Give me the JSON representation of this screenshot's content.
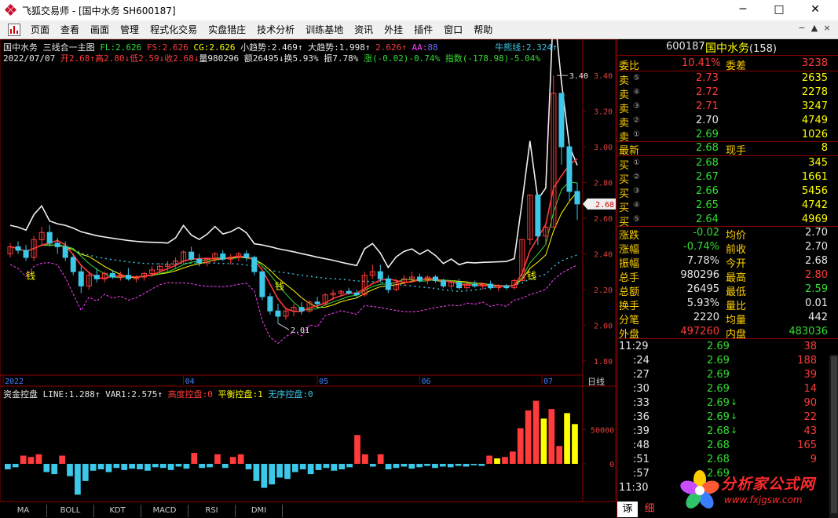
{
  "window": {
    "title": "飞狐交易师 - [国中水务 SH600187]",
    "minimize": "─",
    "maximize": "□",
    "close": "✕"
  },
  "menu": [
    "页面",
    "查看",
    "画面",
    "管理",
    "程式化交易",
    "实盘猎庄",
    "技术分析",
    "训练基地",
    "资讯",
    "外挂",
    "插件",
    "窗口",
    "帮助"
  ],
  "mdi_buttons": [
    "−",
    "▲",
    "×"
  ],
  "colors": {
    "up": "#ff3b3b",
    "down": "#33dd33",
    "label": "#ffd000",
    "cyan": "#3cc8e8",
    "yellow": "#ffff00",
    "magenta": "#ff40ff",
    "grid": "#8b0000"
  },
  "main_header": {
    "stock": "国中水务",
    "formula": "三线合一主图",
    "fl": "FL:2.626",
    "fs": "FS:2.626",
    "cg": "CG:2.626",
    "small_trend": "小趋势:2.469",
    "big_trend": "大趋势:1.998",
    "v3": "2.626",
    "aa": "AA:",
    "aa_val": "88",
    "bear_line": "牛熊线:2.324",
    "date": "2022/07/07",
    "open": "开2.68",
    "high": "高2.80",
    "low": "低2.59",
    "close": "收2.68",
    "volume": "量980296",
    "amount": "额26495",
    "turnover": "换5.93%",
    "amplitude": "振7.78%",
    "change": "涨(-0.02)-0.74%",
    "index": "指数(-178.98)-5.04%"
  },
  "chart_annotations": {
    "high_label": "3.40",
    "low_label": "2.01",
    "current_price_tag": "2.68",
    "money_icon_label": "钱",
    "period_label": "日线"
  },
  "sub_header": {
    "name": "资金控盘",
    "line": "LINE:1.288",
    "var1": "VAR1:2.575",
    "high_ctrl": "高度控盘:0",
    "balance_ctrl": "平衡控盘:1",
    "no_ctrl": "无序控盘:0"
  },
  "indicator_tabs": [
    "MA",
    "BOLL",
    "KDT",
    "MACD",
    "RSI",
    "DMI"
  ],
  "chart_data": [
    {
      "type": "candlestick",
      "title": "三线合一主图",
      "x_ticks": [
        "2022",
        "04",
        "05",
        "06",
        "07"
      ],
      "y_ticks": [
        1.8,
        2.0,
        2.2,
        2.4,
        2.6,
        2.8,
        3.0,
        3.2,
        3.4
      ],
      "ylim": [
        1.72,
        3.48
      ],
      "series": [
        {
          "name": "FL",
          "color": "#33dd33"
        },
        {
          "name": "FS",
          "color": "#ff3b3b"
        },
        {
          "name": "CG",
          "color": "#ffff00"
        },
        {
          "name": "小趋势",
          "color": "#ff40ff"
        },
        {
          "name": "大趋势",
          "color": "#e8e8e8"
        },
        {
          "name": "牛熊线",
          "color": "#3cc8e8"
        }
      ],
      "candles": [
        [
          2.4,
          2.46,
          2.38,
          2.44
        ],
        [
          2.44,
          2.47,
          2.4,
          2.42
        ],
        [
          2.42,
          2.45,
          2.36,
          2.38
        ],
        [
          2.38,
          2.5,
          2.36,
          2.48
        ],
        [
          2.48,
          2.55,
          2.45,
          2.52
        ],
        [
          2.52,
          2.56,
          2.44,
          2.46
        ],
        [
          2.46,
          2.49,
          2.4,
          2.44
        ],
        [
          2.44,
          2.47,
          2.36,
          2.38
        ],
        [
          2.38,
          2.4,
          2.28,
          2.3
        ],
        [
          2.3,
          2.33,
          2.18,
          2.22
        ],
        [
          2.22,
          2.3,
          2.2,
          2.28
        ],
        [
          2.28,
          2.32,
          2.24,
          2.26
        ],
        [
          2.26,
          2.3,
          2.24,
          2.29
        ],
        [
          2.29,
          2.31,
          2.26,
          2.27
        ],
        [
          2.27,
          2.3,
          2.25,
          2.28
        ],
        [
          2.28,
          2.32,
          2.25,
          2.26
        ],
        [
          2.26,
          2.28,
          2.24,
          2.27
        ],
        [
          2.27,
          2.3,
          2.25,
          2.29
        ],
        [
          2.29,
          2.33,
          2.27,
          2.31
        ],
        [
          2.31,
          2.35,
          2.29,
          2.33
        ],
        [
          2.33,
          2.36,
          2.3,
          2.34
        ],
        [
          2.34,
          2.38,
          2.32,
          2.36
        ],
        [
          2.36,
          2.42,
          2.34,
          2.41
        ],
        [
          2.41,
          2.44,
          2.36,
          2.37
        ],
        [
          2.37,
          2.4,
          2.33,
          2.35
        ],
        [
          2.35,
          2.38,
          2.33,
          2.37
        ],
        [
          2.37,
          2.41,
          2.35,
          2.4
        ],
        [
          2.4,
          2.42,
          2.36,
          2.37
        ],
        [
          2.37,
          2.4,
          2.34,
          2.38
        ],
        [
          2.38,
          2.41,
          2.36,
          2.4
        ],
        [
          2.4,
          2.42,
          2.36,
          2.38
        ],
        [
          2.38,
          2.39,
          2.28,
          2.3
        ],
        [
          2.3,
          2.3,
          2.14,
          2.16
        ],
        [
          2.16,
          2.18,
          2.06,
          2.08
        ],
        [
          2.08,
          2.12,
          2.01,
          2.05
        ],
        [
          2.05,
          2.1,
          2.03,
          2.08
        ],
        [
          2.08,
          2.12,
          2.05,
          2.1
        ],
        [
          2.1,
          2.13,
          2.06,
          2.08
        ],
        [
          2.08,
          2.14,
          2.07,
          2.13
        ],
        [
          2.13,
          2.16,
          2.1,
          2.12
        ],
        [
          2.12,
          2.18,
          2.11,
          2.17
        ],
        [
          2.17,
          2.2,
          2.14,
          2.18
        ],
        [
          2.18,
          2.2,
          2.16,
          2.19
        ],
        [
          2.19,
          2.21,
          2.17,
          2.18
        ],
        [
          2.18,
          2.2,
          2.15,
          2.17
        ],
        [
          2.17,
          2.3,
          2.16,
          2.28
        ],
        [
          2.28,
          2.34,
          2.26,
          2.3
        ],
        [
          2.3,
          2.34,
          2.24,
          2.26
        ],
        [
          2.26,
          2.28,
          2.18,
          2.2
        ],
        [
          2.2,
          2.26,
          2.19,
          2.24
        ],
        [
          2.24,
          2.28,
          2.22,
          2.26
        ],
        [
          2.26,
          2.3,
          2.24,
          2.27
        ],
        [
          2.27,
          2.29,
          2.24,
          2.25
        ],
        [
          2.25,
          2.28,
          2.23,
          2.27
        ],
        [
          2.27,
          2.28,
          2.24,
          2.25
        ],
        [
          2.25,
          2.26,
          2.21,
          2.22
        ],
        [
          2.22,
          2.25,
          2.2,
          2.24
        ],
        [
          2.24,
          2.26,
          2.2,
          2.21
        ],
        [
          2.21,
          2.24,
          2.2,
          2.23
        ],
        [
          2.23,
          2.25,
          2.21,
          2.22
        ],
        [
          2.22,
          2.24,
          2.2,
          2.23
        ],
        [
          2.23,
          2.25,
          2.2,
          2.21
        ],
        [
          2.21,
          2.23,
          2.19,
          2.22
        ],
        [
          2.22,
          2.23,
          2.2,
          2.21
        ],
        [
          2.21,
          2.26,
          2.2,
          2.25
        ],
        [
          2.25,
          2.48,
          2.25,
          2.48
        ],
        [
          2.48,
          2.73,
          2.45,
          2.73
        ],
        [
          2.73,
          2.73,
          2.45,
          2.5
        ],
        [
          2.5,
          2.56,
          2.45,
          2.55
        ],
        [
          2.55,
          3.4,
          2.55,
          3.3
        ],
        [
          3.3,
          3.3,
          2.9,
          3.0
        ],
        [
          3.0,
          3.02,
          2.7,
          2.75
        ],
        [
          2.75,
          2.8,
          2.59,
          2.68
        ]
      ],
      "sub_chart": {
        "name": "资金控盘",
        "y_ticks": [
          0,
          50000
        ],
        "values": [
          -8000,
          -5000,
          12000,
          10000,
          14000,
          -12000,
          -15000,
          12000,
          -18000,
          -45000,
          -25000,
          -10000,
          -8000,
          -12000,
          -6000,
          -9000,
          -7000,
          -8000,
          -10000,
          -5000,
          -6000,
          -9000,
          -4000,
          -7000,
          16000,
          -6000,
          -5000,
          14000,
          -6000,
          10000,
          14000,
          -8000,
          -25000,
          -35000,
          -30000,
          -20000,
          -22000,
          -12000,
          -8000,
          -15000,
          -9000,
          -6000,
          -10000,
          -8000,
          -5000,
          42000,
          14000,
          -4000,
          14000,
          -8000,
          -6000,
          -4000,
          -7000,
          -5000,
          -3000,
          -6000,
          -4000,
          -5000,
          -3000,
          -4000,
          -2000,
          -3000,
          12000,
          8000,
          10000,
          18000,
          52000,
          78000,
          92000,
          66000,
          80000,
          26000,
          74000,
          58000
        ]
      }
    }
  ],
  "quote": {
    "code": "600187",
    "name": "国中水务",
    "count": "(158)",
    "weibi_label": "委比",
    "weibi": "10.41%",
    "weicha_label": "委差",
    "weicha": "3238",
    "sells": [
      {
        "label": "卖",
        "idx": "⑤",
        "price": "2.73",
        "vol": "2635"
      },
      {
        "label": "卖",
        "idx": "④",
        "price": "2.72",
        "vol": "2278"
      },
      {
        "label": "卖",
        "idx": "③",
        "price": "2.71",
        "vol": "3247"
      },
      {
        "label": "卖",
        "idx": "②",
        "price": "2.70",
        "vol": "4749"
      },
      {
        "label": "卖",
        "idx": "①",
        "price": "2.69",
        "vol": "1026"
      }
    ],
    "latest_label": "最新",
    "latest": "2.68",
    "now_hand_label": "现手",
    "now_hand": "8",
    "buys": [
      {
        "label": "买",
        "idx": "①",
        "price": "2.68",
        "vol": "345"
      },
      {
        "label": "买",
        "idx": "②",
        "price": "2.67",
        "vol": "1661"
      },
      {
        "label": "买",
        "idx": "③",
        "price": "2.66",
        "vol": "5456"
      },
      {
        "label": "买",
        "idx": "④",
        "price": "2.65",
        "vol": "4742"
      },
      {
        "label": "买",
        "idx": "⑤",
        "price": "2.64",
        "vol": "4969"
      }
    ],
    "stats": [
      {
        "l1": "涨跌",
        "v1": "-0.02",
        "l2": "均价",
        "v2": "2.70"
      },
      {
        "l1": "涨幅",
        "v1": "-0.74%",
        "l2": "前收",
        "v2": "2.70"
      },
      {
        "l1": "振幅",
        "v1": "7.78%",
        "l2": "今开",
        "v2": "2.68"
      },
      {
        "l1": "总手",
        "v1": "980296",
        "l2": "最高",
        "v2": "2.80"
      },
      {
        "l1": "总额",
        "v1": "26495",
        "l2": "最低",
        "v2": "2.59"
      },
      {
        "l1": "换手",
        "v1": "5.93%",
        "l2": "量比",
        "v2": "0.01"
      },
      {
        "l1": "分笔",
        "v1": "2220",
        "l2": "均量",
        "v2": "442"
      },
      {
        "l1": "外盘",
        "v1": "497260",
        "l2": "内盘",
        "v2": "483036"
      }
    ],
    "ticks": [
      {
        "time": "11:29",
        "price": "2.69",
        "arrow": "",
        "vol": "38"
      },
      {
        "time": ":24",
        "price": "2.69",
        "arrow": "",
        "vol": "188"
      },
      {
        "time": ":27",
        "price": "2.69",
        "arrow": "",
        "vol": "39"
      },
      {
        "time": ":30",
        "price": "2.69",
        "arrow": "",
        "vol": "14"
      },
      {
        "time": ":33",
        "price": "2.69",
        "arrow": "↓",
        "vol": "90"
      },
      {
        "time": ":36",
        "price": "2.69",
        "arrow": "↓",
        "vol": "22"
      },
      {
        "time": ":39",
        "price": "2.68",
        "arrow": "↓",
        "vol": "43"
      },
      {
        "time": ":48",
        "price": "2.68",
        "arrow": "",
        "vol": "165"
      },
      {
        "time": ":51",
        "price": "2.68",
        "arrow": "",
        "vol": "9"
      },
      {
        "time": ":57",
        "price": "2.69",
        "arrow": "",
        "vol": ""
      },
      {
        "time": "11:30",
        "price": "",
        "arrow": "",
        "vol": ""
      }
    ],
    "bottom_tabs": [
      "诼",
      "细"
    ]
  },
  "watermark": {
    "site_name": "分析家公式网",
    "url": "www.fxjgsw.com"
  }
}
